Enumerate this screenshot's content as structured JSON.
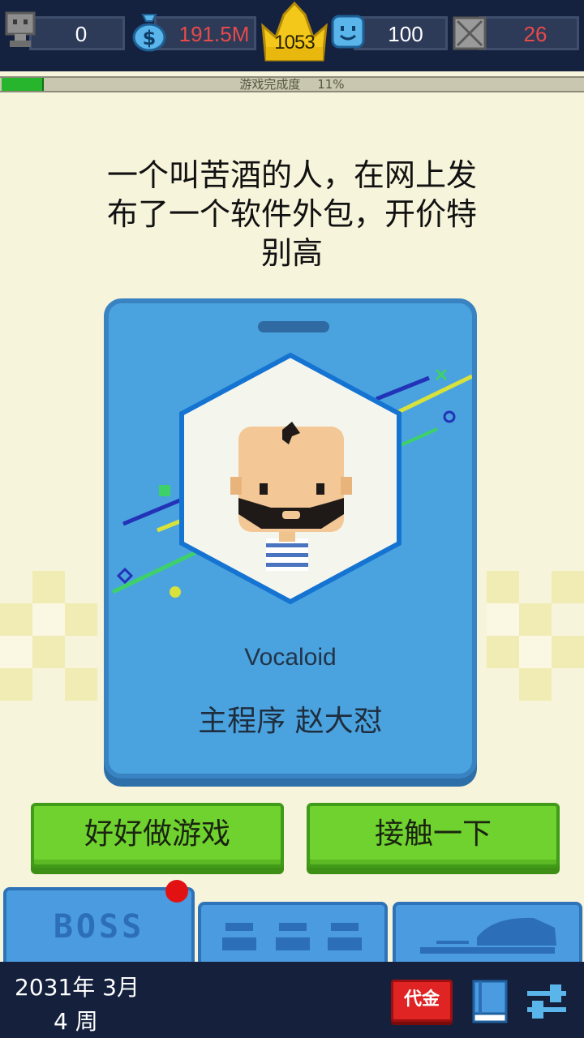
{
  "topbar": {
    "fans": "0",
    "money": "191.5M",
    "rank": "1053",
    "mood": "100",
    "bugs": "26"
  },
  "progress": {
    "label": "游戏完成度",
    "percent_text": "11%",
    "value": 0.11
  },
  "event": {
    "text": "一个叫苦酒的人，在网上发布了一个软件外包，开价特别高"
  },
  "card": {
    "company": "Vocaloid",
    "name": "主程序 赵大怼"
  },
  "actions": {
    "left_label": "好好做游戏",
    "right_label": "接触一下"
  },
  "tabs": {
    "boss_label": "BOSS"
  },
  "date": {
    "line1": "2031年 3月",
    "line2": "4 周"
  },
  "bottom": {
    "voucher_label": "代金"
  },
  "colors": {
    "topbar_bg": "#15223f",
    "money_text": "#e64a4a",
    "bugs_text": "#e64a4a",
    "progress_fill": "#26b52c",
    "card_bg": "#4aa3de",
    "action_button": "#6fd22e",
    "tab_bg": "#4a9be0",
    "badge": "#e31212"
  }
}
